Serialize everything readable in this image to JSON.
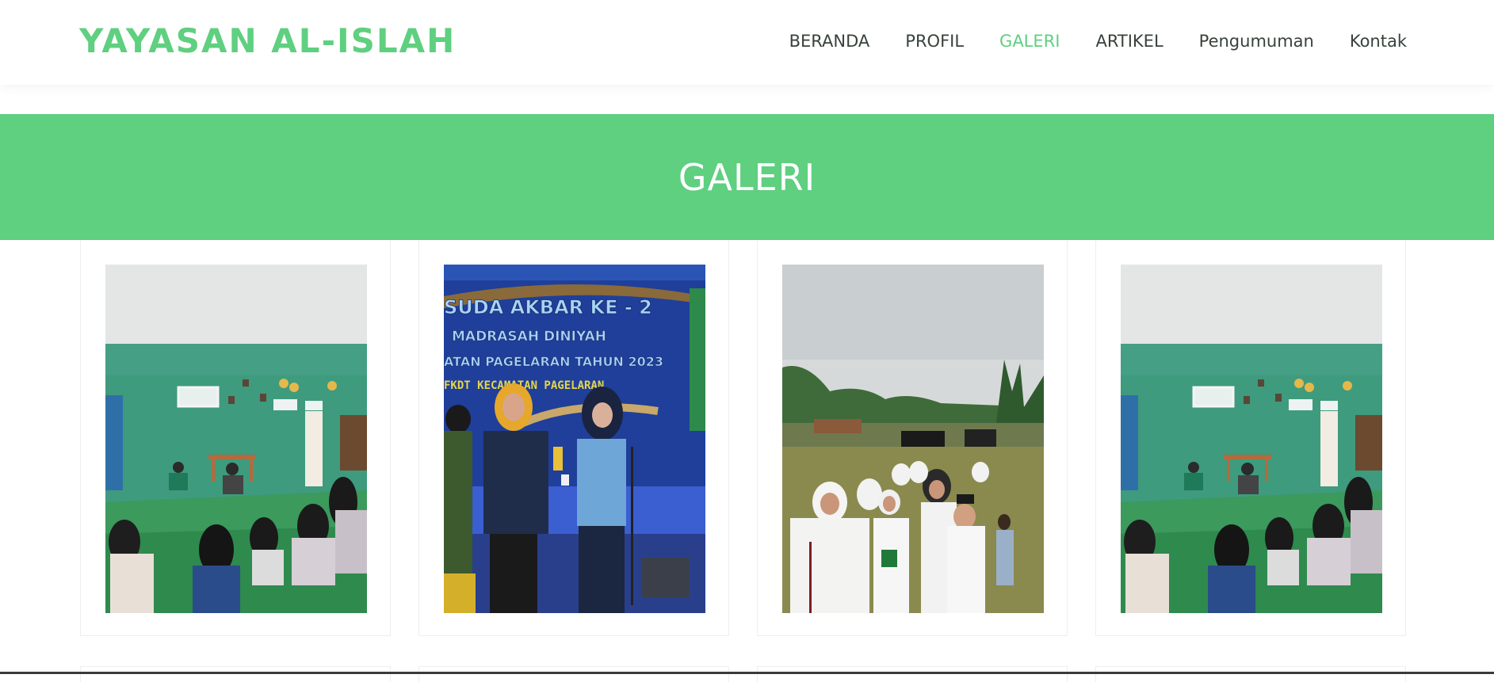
{
  "header": {
    "logo": "YAYASAN AL-ISLAH",
    "nav": [
      {
        "label": "BERANDA",
        "active": false
      },
      {
        "label": "PROFIL",
        "active": false
      },
      {
        "label": "GALERI",
        "active": true
      },
      {
        "label": "ARTIKEL",
        "active": false
      },
      {
        "label": "Pengumuman",
        "active": false
      },
      {
        "label": "Kontak",
        "active": false
      }
    ]
  },
  "page": {
    "title": "GALERI"
  },
  "gallery": {
    "photos": [
      {
        "subject": "classroom-gathering-photo"
      },
      {
        "subject": "award-ceremony-photo",
        "banner_lines": [
          "SUDA AKBAR KE - 2",
          "MADRASAH DINIYAH",
          "ATAN PAGELARAN TAHUN 2023",
          "FKDT KECAMATAN PAGELARAN"
        ]
      },
      {
        "subject": "outdoor-students-photo"
      },
      {
        "subject": "classroom-gathering-photo"
      }
    ]
  },
  "colors": {
    "accent": "#5fcf80",
    "nav_text": "#37423b",
    "title_text": "#ffffff"
  }
}
